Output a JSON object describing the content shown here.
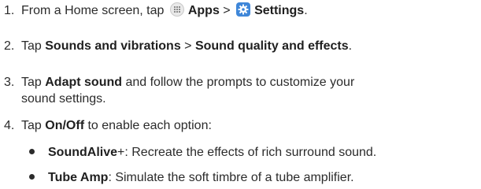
{
  "steps": [
    {
      "number": "1.",
      "parts": [
        "From a Home screen, tap ",
        "Apps",
        " > ",
        "Settings",
        "."
      ]
    },
    {
      "number": "2.",
      "parts": [
        "Tap ",
        "Sounds and vibrations",
        " > ",
        "Sound quality and effects",
        "."
      ]
    },
    {
      "number": "3.",
      "parts": [
        "Tap ",
        "Adapt sound",
        " and follow the prompts to customize your"
      ],
      "continuation": "sound settings."
    },
    {
      "number": "4.",
      "parts": [
        "Tap ",
        "On/Off",
        " to enable each option:"
      ]
    }
  ],
  "options": [
    {
      "name": "SoundAlive",
      "name_suffix": "+",
      "description": ": Recreate the effects of rich surround sound."
    },
    {
      "name": "Tube Amp",
      "description": ": Simulate the soft timbre of a tube amplifier."
    }
  ],
  "icons": {
    "apps": "apps-grid-icon",
    "settings": "settings-gear-icon",
    "settings_color": "#3f87d9"
  }
}
